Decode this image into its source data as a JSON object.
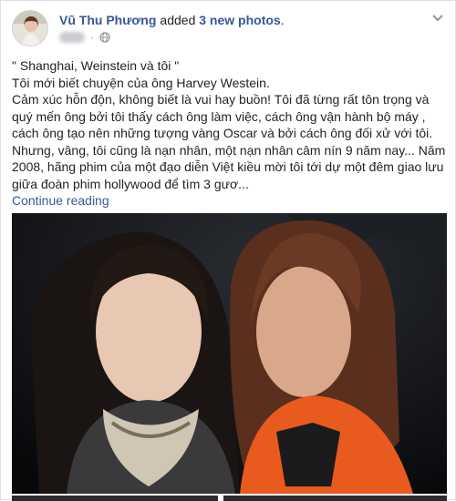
{
  "post": {
    "author": "Vũ Thu Phương",
    "action_prefix": "added",
    "action_highlight": "3 new photos",
    "action_suffix": ".",
    "dot": "·",
    "privacy_icon": "globe-icon",
    "menu_icon": "chevron-down-icon"
  },
  "body": {
    "line1": "\" Shanghai, Weinstein và tôi \"",
    "line2": "Tôi mới biết chuyện của ông Harvey Westein.",
    "line3": "Cảm xúc hỗn độn, không biết là vui hay buồn! Tôi đã từng rất tôn trọng và quý mến ông bởi tôi thấy cách ông làm việc, cách ông vận hành bộ máy , cách ông tạo nên những tượng vàng Oscar và bởi cách ông đối xử với tôi. Nhưng, vâng, tôi cũng là nạn nhân, một nạn nhân câm nín 9 năm nay... Năm 2008, hãng phim của một đạo diễn Việt kiều mời tôi tới dự một đêm giao lưu giữa đoàn phim hollywood để tìm 3 gươ...",
    "continue": "Continue reading"
  },
  "colors": {
    "link": "#365899",
    "text": "#1d2129",
    "muted": "#90949c",
    "border": "#dddfe2"
  }
}
